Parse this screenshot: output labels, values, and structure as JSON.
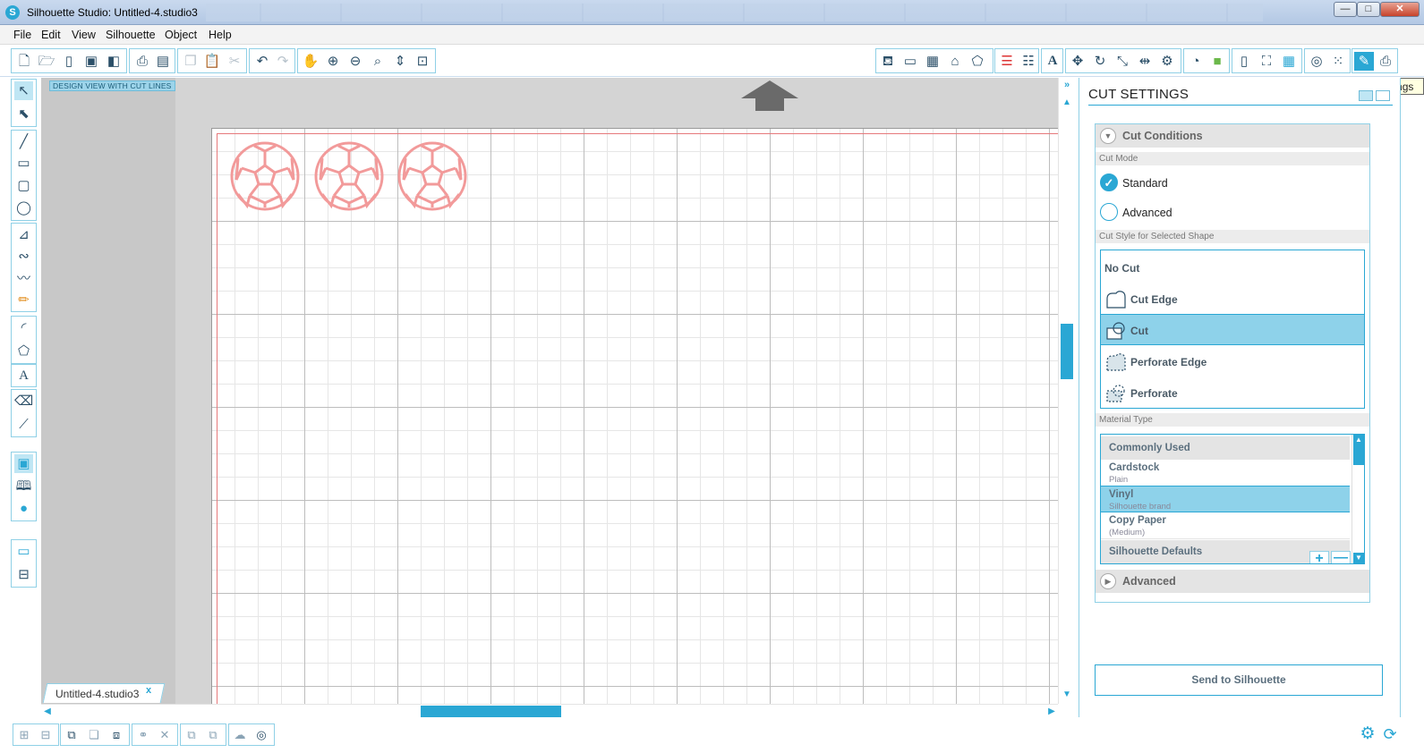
{
  "window": {
    "title": "Silhouette Studio: Untitled-4.studio3",
    "app_icon_letter": "S",
    "controls": {
      "minimize": "—",
      "maximize": "□",
      "close": "✕"
    }
  },
  "menu": [
    "File",
    "Edit",
    "View",
    "Silhouette",
    "Object",
    "Help"
  ],
  "toolbar": {
    "tooltip": "Cut Settings"
  },
  "canvas": {
    "view_label": "DESIGN VIEW WITH CUT LINES",
    "document_tab": "Untitled-4.studio3",
    "document_tab_close": "x",
    "shapes_count": 3,
    "cut_line_color": "#f29a9a",
    "grid_color": "#bdbdbd"
  },
  "panel": {
    "title": "CUT SETTINGS",
    "cut_conditions_label": "Cut Conditions",
    "cut_mode_label": "Cut Mode",
    "cut_modes": [
      {
        "label": "Standard",
        "checked": true
      },
      {
        "label": "Advanced",
        "checked": false
      }
    ],
    "cut_style_label": "Cut Style for Selected Shape",
    "cut_styles": [
      {
        "label": "No Cut",
        "selected": false
      },
      {
        "label": "Cut Edge",
        "selected": false
      },
      {
        "label": "Cut",
        "selected": true
      },
      {
        "label": "Perforate Edge",
        "selected": false
      },
      {
        "label": "Perforate",
        "selected": false
      }
    ],
    "material_type_label": "Material Type",
    "material_groups": {
      "commonly_used": "Commonly Used",
      "silhouette_defaults": "Silhouette Defaults"
    },
    "materials": [
      {
        "name": "Cardstock",
        "sub": "Plain",
        "selected": false
      },
      {
        "name": "Vinyl",
        "sub": "Silhouette brand",
        "selected": true
      },
      {
        "name": "Copy Paper",
        "sub": "(Medium)",
        "selected": false
      }
    ],
    "add_label": "+",
    "remove_label": "—",
    "advanced_label": "Advanced",
    "send_button": "Send to Silhouette"
  },
  "colors": {
    "accent": "#2aa7d4",
    "selection": "#8ed2ea",
    "shape_stroke": "#f29a9a"
  }
}
